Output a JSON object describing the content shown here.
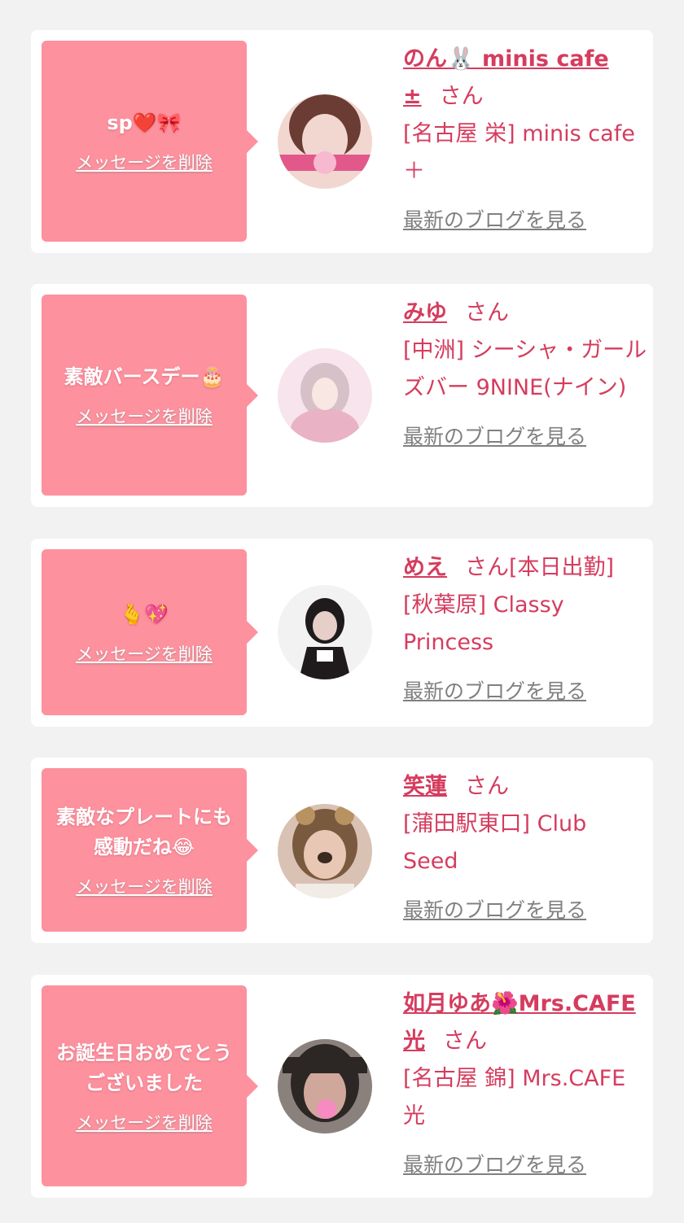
{
  "cards": [
    {
      "message": "sp❤️🎀",
      "delete_label": "メッセージを削除",
      "name": "のん🐰 minis cafe ±",
      "honorific": "さん",
      "status": "",
      "shop": "[名古屋 栄] minis cafe ＋",
      "blog_label": "最新のブログを見る",
      "avatar_colors": [
        "#6b3c33",
        "#f1d7d0",
        "#e2588a"
      ]
    },
    {
      "message": "素敵バースデー🎂 ",
      "delete_label": "メッセージを削除",
      "name": "みゆ",
      "honorific": "さん",
      "status": "",
      "shop": "[中洲] シーシャ・ガールズバー 9NINE(ナイン)",
      "blog_label": "最新のブログを見る",
      "avatar_colors": [
        "#f7e4ec",
        "#e9b3c5",
        "#d6c1c8"
      ]
    },
    {
      "message": "🫰💖",
      "delete_label": "メッセージを削除",
      "name": "めえ",
      "honorific": "さん",
      "status": "[本日出勤]",
      "shop": "[秋葉原] Classy Princess",
      "blog_label": "最新のブログを見る",
      "avatar_colors": [
        "#f2f2f2",
        "#1f1b1d",
        "#e6cfc8"
      ]
    },
    {
      "message": "素敵なプレートにも感動だね😂",
      "delete_label": "メッセージを削除",
      "name": "笑蓮",
      "honorific": "さん",
      "status": "",
      "shop": "[蒲田駅東口] Club Seed",
      "blog_label": "最新のブログを見る",
      "avatar_colors": [
        "#7a5a3e",
        "#e8c7b5",
        "#b99262"
      ]
    },
    {
      "message": "お誕生日おめでとうございました",
      "delete_label": "メッセージを削除",
      "name": "如月ゆあ🌺Mrs.CAFE光",
      "honorific": "さん",
      "status": "",
      "shop": "[名古屋 錦] Mrs.CAFE光",
      "blog_label": "最新のブログを見る",
      "avatar_colors": [
        "#2c2624",
        "#cfa89b",
        "#f58bc0"
      ]
    }
  ]
}
